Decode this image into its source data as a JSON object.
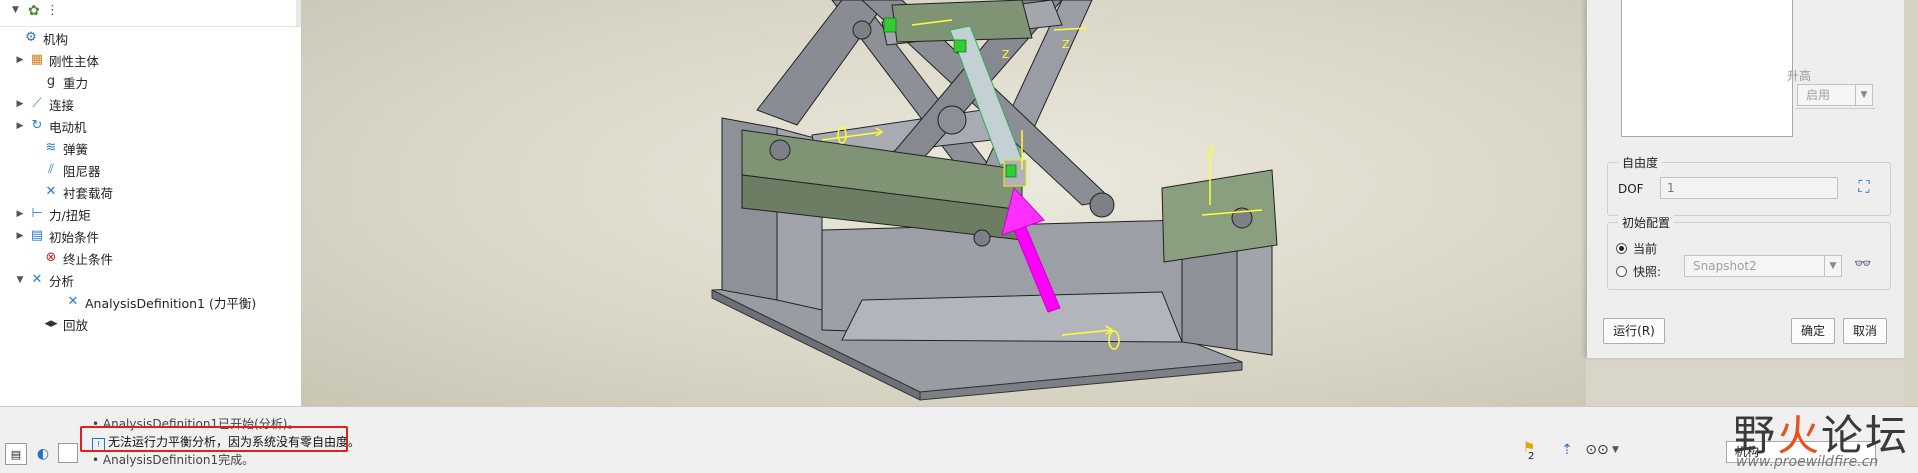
{
  "tree": {
    "items": [
      {
        "label": "机构",
        "twisty": "",
        "icon": "⚙"
      },
      {
        "label": "刚性主体",
        "twisty": "▶",
        "icon": "▦"
      },
      {
        "label": "重力",
        "twisty": "",
        "icon": "g"
      },
      {
        "label": "连接",
        "twisty": "▶",
        "icon": "⟋"
      },
      {
        "label": "电动机",
        "twisty": "▶",
        "icon": "↻"
      },
      {
        "label": "弹簧",
        "twisty": "",
        "icon": "≋"
      },
      {
        "label": "阻尼器",
        "twisty": "",
        "icon": "⫽"
      },
      {
        "label": "衬套载荷",
        "twisty": "",
        "icon": "✕"
      },
      {
        "label": "力/扭矩",
        "twisty": "▶",
        "icon": "⊢"
      },
      {
        "label": "初始条件",
        "twisty": "▶",
        "icon": "▤"
      },
      {
        "label": "终止条件",
        "twisty": "",
        "icon": "⊗"
      },
      {
        "label": "分析",
        "twisty": "▼",
        "icon": "✕"
      },
      {
        "label": "AnalysisDefinition1 (力平衡)",
        "twisty": "",
        "icon": "✕"
      },
      {
        "label": "回放",
        "twisty": "",
        "icon": "◂▸"
      }
    ]
  },
  "dialog": {
    "lift_label": "升高",
    "enable_value": "启用",
    "dof_group": "自由度",
    "dof_label": "DOF",
    "dof_value": "1",
    "initcfg_group": "初始配置",
    "radio_current": "当前",
    "radio_snapshot": "快照:",
    "snapshot_value": "Snapshot2",
    "run_button": "运行(R)",
    "ok_button": "确定",
    "cancel_button": "取消"
  },
  "status": {
    "messages": [
      "• AnalysisDefinition1已开始(分析)。",
      "无法运行力平衡分析，因为系统没有零自由度。",
      "• AnalysisDefinition1完成。"
    ],
    "flag_count": "2",
    "mechanism_value": "机构"
  },
  "watermark": {
    "title_a": "野",
    "title_b": "火",
    "title_c": "论坛",
    "url": "www.proewildfire.cn"
  },
  "colors": {
    "highlight": "#e0201d",
    "model_gray": "#8a8c94",
    "rail_green": "#7f9475",
    "force_magenta": "#ff00ff",
    "axis_yellow": "#ffff33"
  }
}
